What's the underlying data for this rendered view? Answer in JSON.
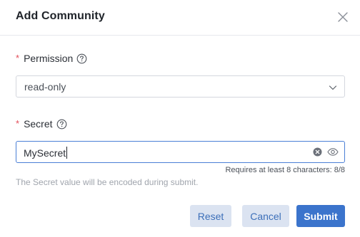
{
  "dialog": {
    "title": "Add Community"
  },
  "form": {
    "required_marker": "*",
    "permission": {
      "label": "Permission",
      "value": "read-only"
    },
    "secret": {
      "label": "Secret",
      "value": "MySecret",
      "counter": "Requires at least 8 characters: 8/8",
      "hint": "The Secret value will be encoded during submit."
    }
  },
  "buttons": {
    "reset": "Reset",
    "cancel": "Cancel",
    "submit": "Submit"
  },
  "icons": {
    "close": "close-icon",
    "help": "question-circle-icon",
    "dropdown": "chevron-down-icon",
    "clear": "clear-circle-icon",
    "visibility": "eye-icon"
  },
  "colors": {
    "primary": "#3b74cc",
    "required": "#e34d59",
    "input_focus_border": "#4a7fd6",
    "secondary_button_bg": "#dbe3f1"
  }
}
